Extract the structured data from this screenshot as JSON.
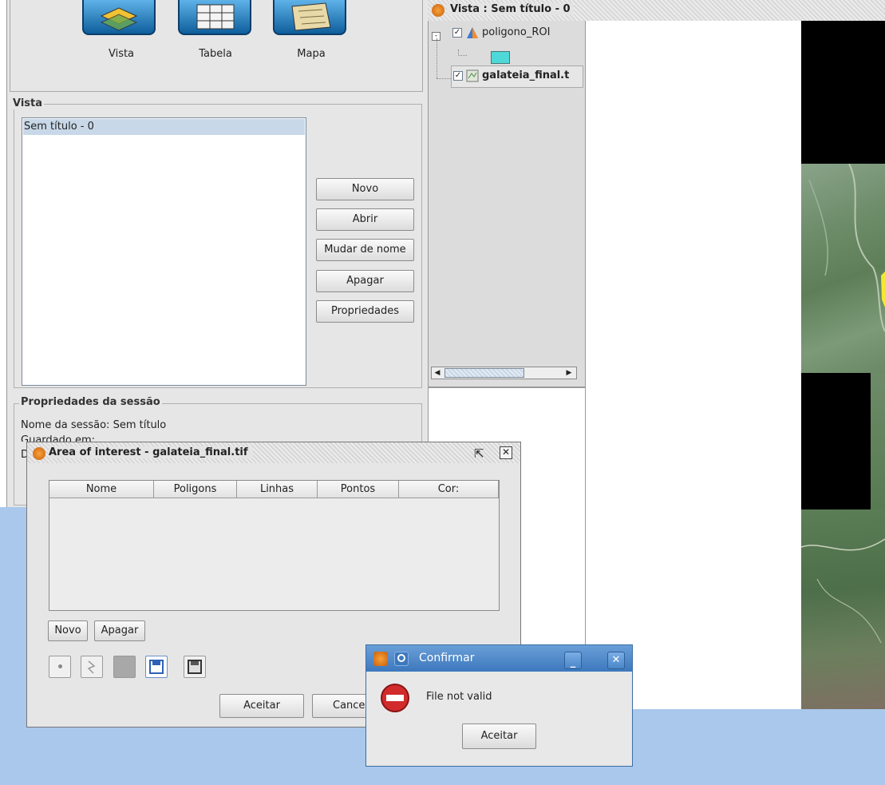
{
  "project_manager": {
    "doc_types": [
      {
        "label": "Vista",
        "icon": "vista-layers-icon"
      },
      {
        "label": "Tabela",
        "icon": "table-grid-icon"
      },
      {
        "label": "Mapa",
        "icon": "map-sheet-icon"
      }
    ],
    "views_group": {
      "legend": "Vista",
      "items": [
        "Sem título - 0"
      ],
      "buttons": {
        "new": "Novo",
        "open": "Abrir",
        "rename": "Mudar de nome",
        "delete": "Apagar",
        "properties": "Propriedades"
      }
    },
    "session": {
      "legend": "Propriedades da sessão",
      "name_label": "Nome da sessão:",
      "name_value": "Sem título",
      "saved_label": "Guardado em:",
      "third_label_initial": "D"
    }
  },
  "view_window": {
    "title": "Vista : Sem título - 0",
    "layers": [
      {
        "name": "poligono_ROI",
        "checked": true,
        "icon": "polygon-layer-icon"
      },
      {
        "name": "galateia_final.t",
        "checked": true,
        "icon": "raster-layer-icon"
      }
    ],
    "legend_swatch_color": "#4fd8d8"
  },
  "aoi_dialog": {
    "title": "Area of interest - galateia_final.tif",
    "columns": [
      "Nome",
      "Poligons",
      "Linhas",
      "Pontos",
      "Cor:"
    ],
    "buttons": {
      "new": "Novo",
      "delete": "Apagar",
      "accept": "Aceitar",
      "cancel": "Cance"
    },
    "tools": [
      "point-tool-icon",
      "line-tool-icon",
      "polygon-tool-icon",
      "save-icon",
      "save-as-icon"
    ]
  },
  "confirm_dialog": {
    "title": "Confirmar",
    "message": "File not valid",
    "ok": "Aceitar",
    "accent": "#3d78bd"
  }
}
